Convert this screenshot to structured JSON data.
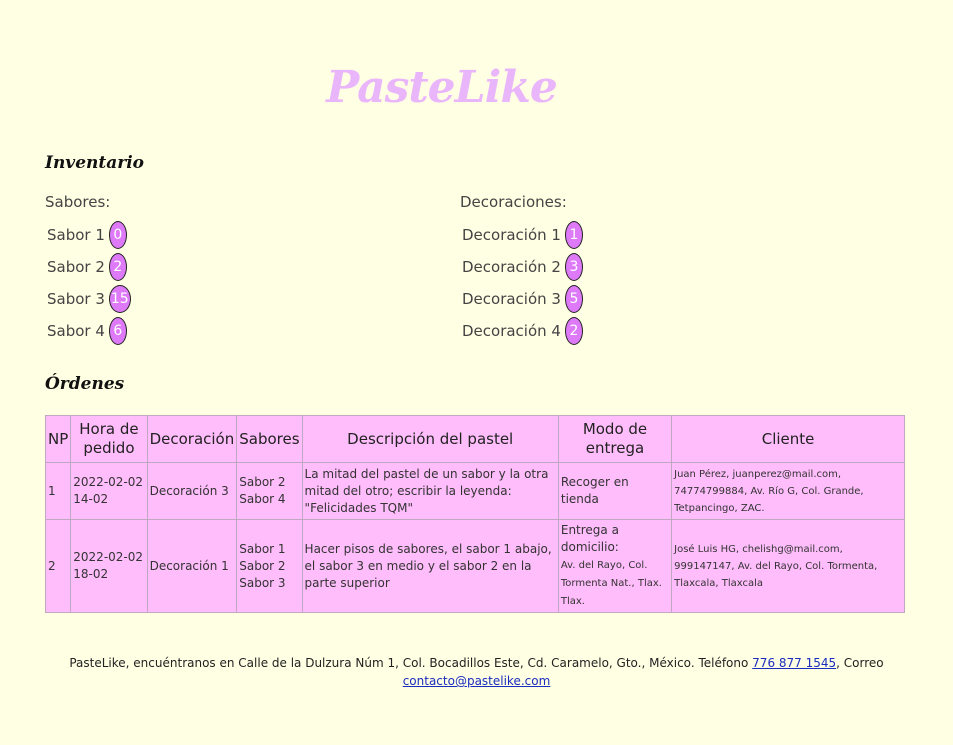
{
  "brand": {
    "logo": "PasteLike"
  },
  "inventory": {
    "title": "Inventario",
    "flavors": {
      "heading": "Sabores:",
      "items": [
        {
          "label": "Sabor 1",
          "count": "0"
        },
        {
          "label": "Sabor 2",
          "count": "2"
        },
        {
          "label": "Sabor 3",
          "count": "15"
        },
        {
          "label": "Sabor 4",
          "count": "6"
        }
      ]
    },
    "decorations": {
      "heading": "Decoraciones:",
      "items": [
        {
          "label": "Decoración 1",
          "count": "1"
        },
        {
          "label": "Decoración 2",
          "count": "3"
        },
        {
          "label": "Decoración 3",
          "count": "5"
        },
        {
          "label": "Decoración 4",
          "count": "2"
        }
      ]
    }
  },
  "orders": {
    "title": "Órdenes",
    "headers": [
      "NP",
      "Hora de pedido",
      "Decoración",
      "Sabores",
      "Descripción del pastel",
      "Modo de entrega",
      "Cliente"
    ],
    "rows": [
      {
        "np": "1",
        "date": "2022-02-02",
        "time": "14-02",
        "decoration": "Decoración 3",
        "flavors": [
          "Sabor 2",
          "Sabor 4"
        ],
        "description": "La mitad del pastel de un sabor y la otra mitad del otro; escribir la leyenda: \"Felicidades TQM\"",
        "delivery": "Recoger en tienda",
        "delivery_address": "",
        "client": "Juan Pérez, juanperez@mail.com, 74774799884, Av. Río G, Col. Grande, Tetpancingo, ZAC."
      },
      {
        "np": "2",
        "date": "2022-02-02",
        "time": "18-02",
        "decoration": "Decoración 1",
        "flavors": [
          "Sabor 1",
          "Sabor 2",
          "Sabor 3"
        ],
        "description": "Hacer pisos de sabores, el sabor 1 abajo, el sabor 3 en medio y el sabor 2 en la parte superior",
        "delivery": "Entrega a domicilio:",
        "delivery_address": "Av. del Rayo, Col. Tormenta Nat., Tlax. Tlax.",
        "client": "José Luis HG, chelishg@mail.com, 999147147, Av. del Rayo, Col. Tormenta, Tlaxcala, Tlaxcala"
      }
    ]
  },
  "footer": {
    "text_before_phone": "PasteLike, encuéntranos en Calle de la Dulzura Núm 1, Col. Bocadillos Este, Cd. Caramelo, Gto., México. Teléfono ",
    "phone": "776 877 1545",
    "text_before_email": ", Correo ",
    "email": "contacto@pastelike.com"
  },
  "colors": {
    "background": "#ffffe4",
    "logo": "#e9b6fb",
    "badge": "#de7af8",
    "table": "#ffbdfb",
    "link": "#1a2dbe"
  }
}
